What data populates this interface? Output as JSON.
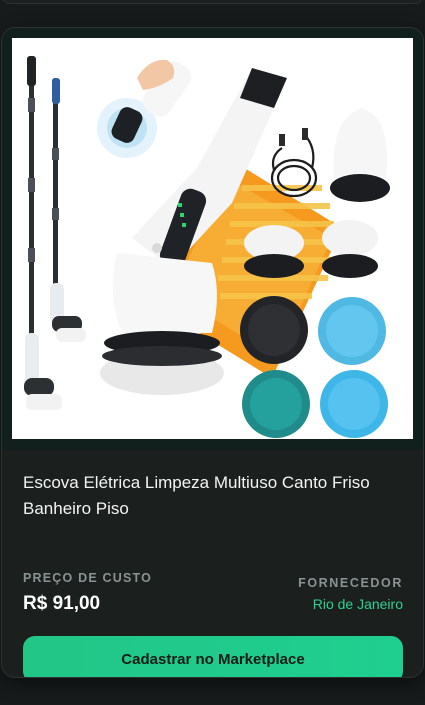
{
  "product": {
    "title": "Escova Elétrica Limpeza Multiuso Canto Friso Banheiro Piso",
    "image_alt": "electric-cleaning-brush-product-photo",
    "cost_label": "PREÇO DE CUSTO",
    "cost_value": "R$ 91,00",
    "supplier_label": "FORNECEDOR",
    "supplier_value": "Rio de Janeiro",
    "cta_label": "Cadastrar no Marketplace"
  },
  "colors": {
    "background": "#171b1b",
    "card": "#1b201f",
    "accent": "#22c687",
    "supplier_text": "#2fcf8f"
  }
}
